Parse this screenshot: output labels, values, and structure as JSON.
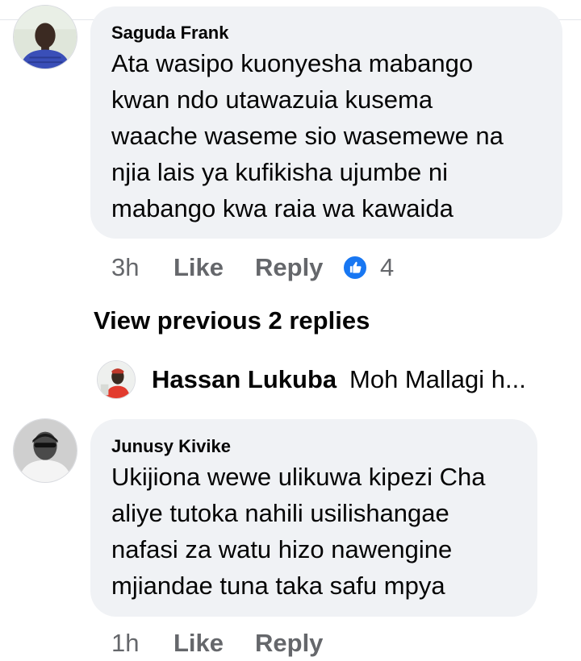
{
  "comments": [
    {
      "author": "Saguda Frank",
      "lines": [
        "Ata wasipo kuonyesha mabango",
        "kwan ndo utawazuia kusema",
        "waache waseme sio wasemewe na",
        "njia lais ya kufikisha ujumbe ni",
        "mabango kwa raia wa kawaida"
      ],
      "time": "3h",
      "like_label": "Like",
      "reply_label": "Reply",
      "reaction_count": "4",
      "reaction_icon": "like-icon"
    },
    {
      "author": "Junusy Kivike",
      "lines": [
        "Ukijiona wewe ulikuwa kipezi Cha",
        "aliye tutoka nahili usilishangae",
        "nafasi za watu hizo nawengine",
        "mjiandae tuna taka safu mpya"
      ],
      "time": "1h",
      "like_label": "Like",
      "reply_label": "Reply"
    }
  ],
  "view_previous_replies": "View previous 2 replies",
  "latest_reply": {
    "author": "Hassan Lukuba",
    "preview": "Moh Mallagi h..."
  },
  "colors": {
    "bubble": "#f0f2f5",
    "meta_text": "#65676b",
    "like_blue": "#1877f2"
  }
}
